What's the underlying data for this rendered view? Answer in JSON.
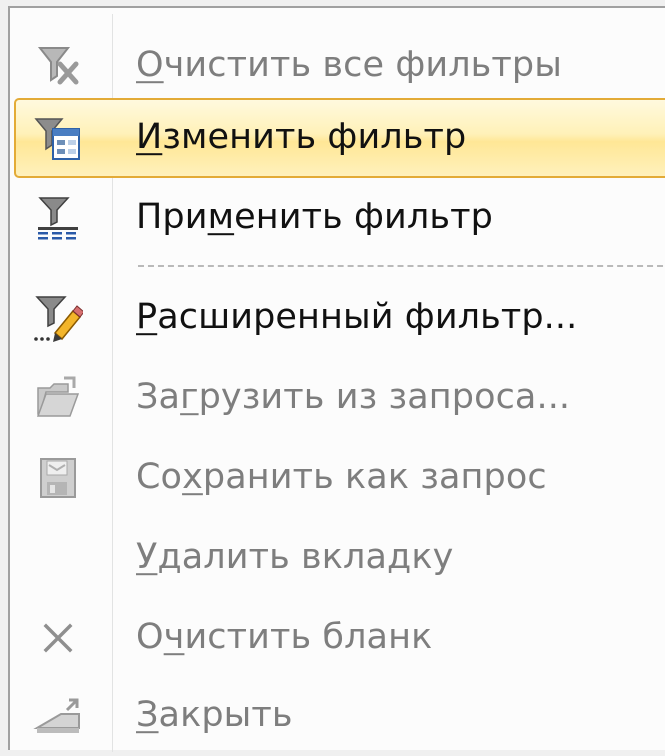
{
  "menu": {
    "items": [
      {
        "icon": "funnel-clear-icon",
        "pre": "",
        "key": "О",
        "post": "чистить все фильтры",
        "enabled": false,
        "selected": false
      },
      {
        "icon": "funnel-form-icon",
        "pre": "",
        "key": "И",
        "post": "зменить фильтр",
        "enabled": true,
        "selected": true
      },
      {
        "icon": "funnel-apply-icon",
        "pre": "При",
        "key": "м",
        "post": "енить фильтр",
        "enabled": true,
        "selected": false
      },
      {
        "icon": "funnel-pencil-icon",
        "pre": "",
        "key": "Р",
        "post": "асширенный фильтр...",
        "enabled": true,
        "selected": false
      },
      {
        "icon": "folder-open-icon",
        "pre": "За",
        "key": "г",
        "post": "рузить из запроса...",
        "enabled": false,
        "selected": false
      },
      {
        "icon": "save-disk-icon",
        "pre": "Со",
        "key": "х",
        "post": "ранить как запрос",
        "enabled": false,
        "selected": false
      },
      {
        "icon": "",
        "pre": "",
        "key": "У",
        "post": "далить вкладку",
        "enabled": false,
        "selected": false
      },
      {
        "icon": "close-x-icon",
        "pre": "О",
        "key": "ч",
        "post": "истить бланк",
        "enabled": false,
        "selected": false
      },
      {
        "icon": "close-window-icon",
        "pre": "",
        "key": "З",
        "post": "акрыть",
        "enabled": false,
        "selected": false
      }
    ]
  }
}
